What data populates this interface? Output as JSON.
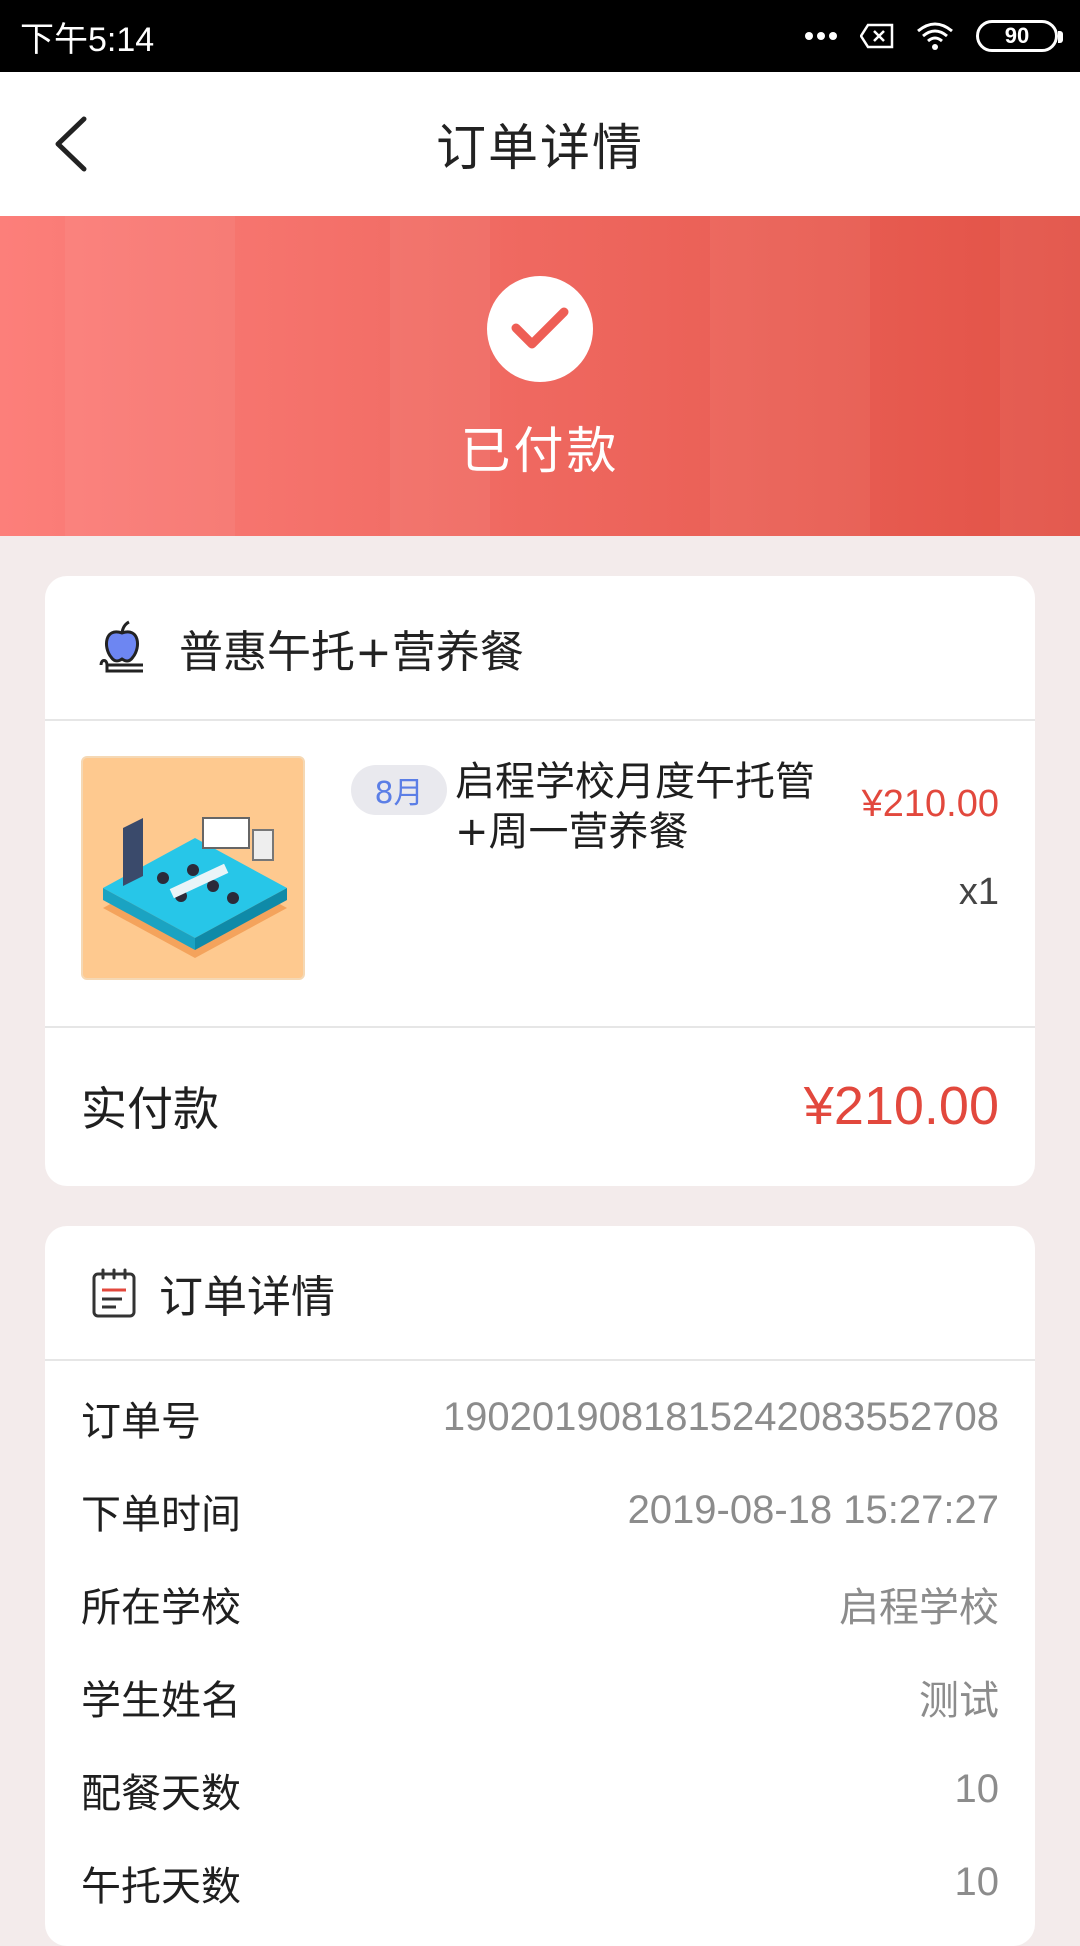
{
  "status_bar": {
    "time": "下午5:14",
    "battery": "90"
  },
  "navbar": {
    "title": "订单详情"
  },
  "banner": {
    "status": "已付款"
  },
  "order_card": {
    "category": "普惠午托+营养餐",
    "product": {
      "tag": "8月",
      "name": "启程学校月度午托管+周一营养餐",
      "price": "¥210.00",
      "quantity": "x1"
    },
    "paid_label": "实付款",
    "paid_amount": "¥210.00"
  },
  "details_card": {
    "title": "订单详情",
    "rows": [
      {
        "label": "订单号",
        "value": "1902019081815242083552708"
      },
      {
        "label": "下单时间",
        "value": "2019-08-18 15:27:27"
      },
      {
        "label": "所在学校",
        "value": "启程学校"
      },
      {
        "label": "学生姓名",
        "value": "测试"
      },
      {
        "label": "配餐天数",
        "value": "10"
      },
      {
        "label": "午托天数",
        "value": "10"
      }
    ]
  },
  "icons": {
    "back": "chevron-left-icon",
    "paid": "check-circle-icon",
    "category": "apple-book-icon",
    "details": "clipboard-icon"
  },
  "colors": {
    "accent_red": "#e2483d",
    "banner_start": "#fc7f7a",
    "banner_end": "#e25246",
    "tag_text": "#5b7ee6"
  }
}
